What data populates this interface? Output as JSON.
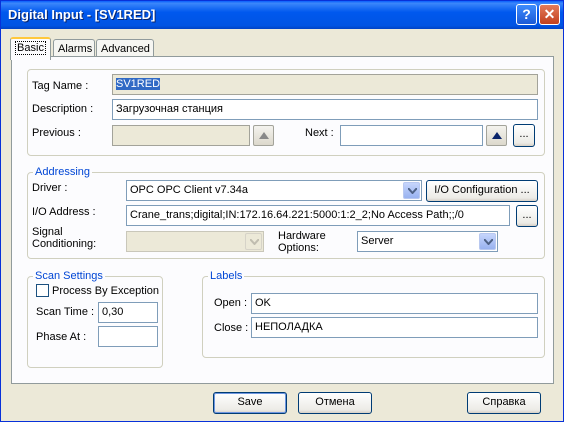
{
  "window": {
    "title": "Digital Input - [SV1RED]"
  },
  "tabs": [
    {
      "label": "Basic"
    },
    {
      "label": "Alarms"
    },
    {
      "label": "Advanced"
    }
  ],
  "basic": {
    "tag_name_label": "Tag Name :",
    "tag_name_value": "SV1RED",
    "description_label": "Description :",
    "description_value": "Загрузочная станция",
    "previous_label": "Previous :",
    "previous_value": "",
    "next_label": "Next :",
    "next_value": "",
    "ellipsis": "..."
  },
  "addressing": {
    "legend": "Addressing",
    "driver_label": "Driver :",
    "driver_value": "OPC    OPC Client v7.34a",
    "io_config_button": "I/O Configuration ...",
    "io_address_label": "I/O Address :",
    "io_address_value": "Crane_trans;digital;IN:172.16.64.221:5000:1:2_2;No Access Path;;/0",
    "ellipsis": "...",
    "signal_label_1": "Signal",
    "signal_label_2": "Conditioning:",
    "signal_value": "",
    "hardware_label_1": "Hardware",
    "hardware_label_2": "Options:",
    "hardware_value": "Server"
  },
  "scan": {
    "legend": "Scan Settings",
    "exception_label": "Process By Exception",
    "exception_checked": false,
    "scan_time_label": "Scan Time :",
    "scan_time_value": "0,30",
    "phase_label": "Phase At :",
    "phase_value": ""
  },
  "labels": {
    "legend": "Labels",
    "open_label": "Open :",
    "open_value": "OK",
    "close_label": "Close :",
    "close_value": "НЕПОЛАДКА"
  },
  "footer": {
    "save": "Save",
    "cancel": "Отмена",
    "help": "Справка"
  },
  "colors": {
    "title_bar": "#0054e3",
    "legend_text": "#0046d5",
    "selection": "#316ac5"
  }
}
